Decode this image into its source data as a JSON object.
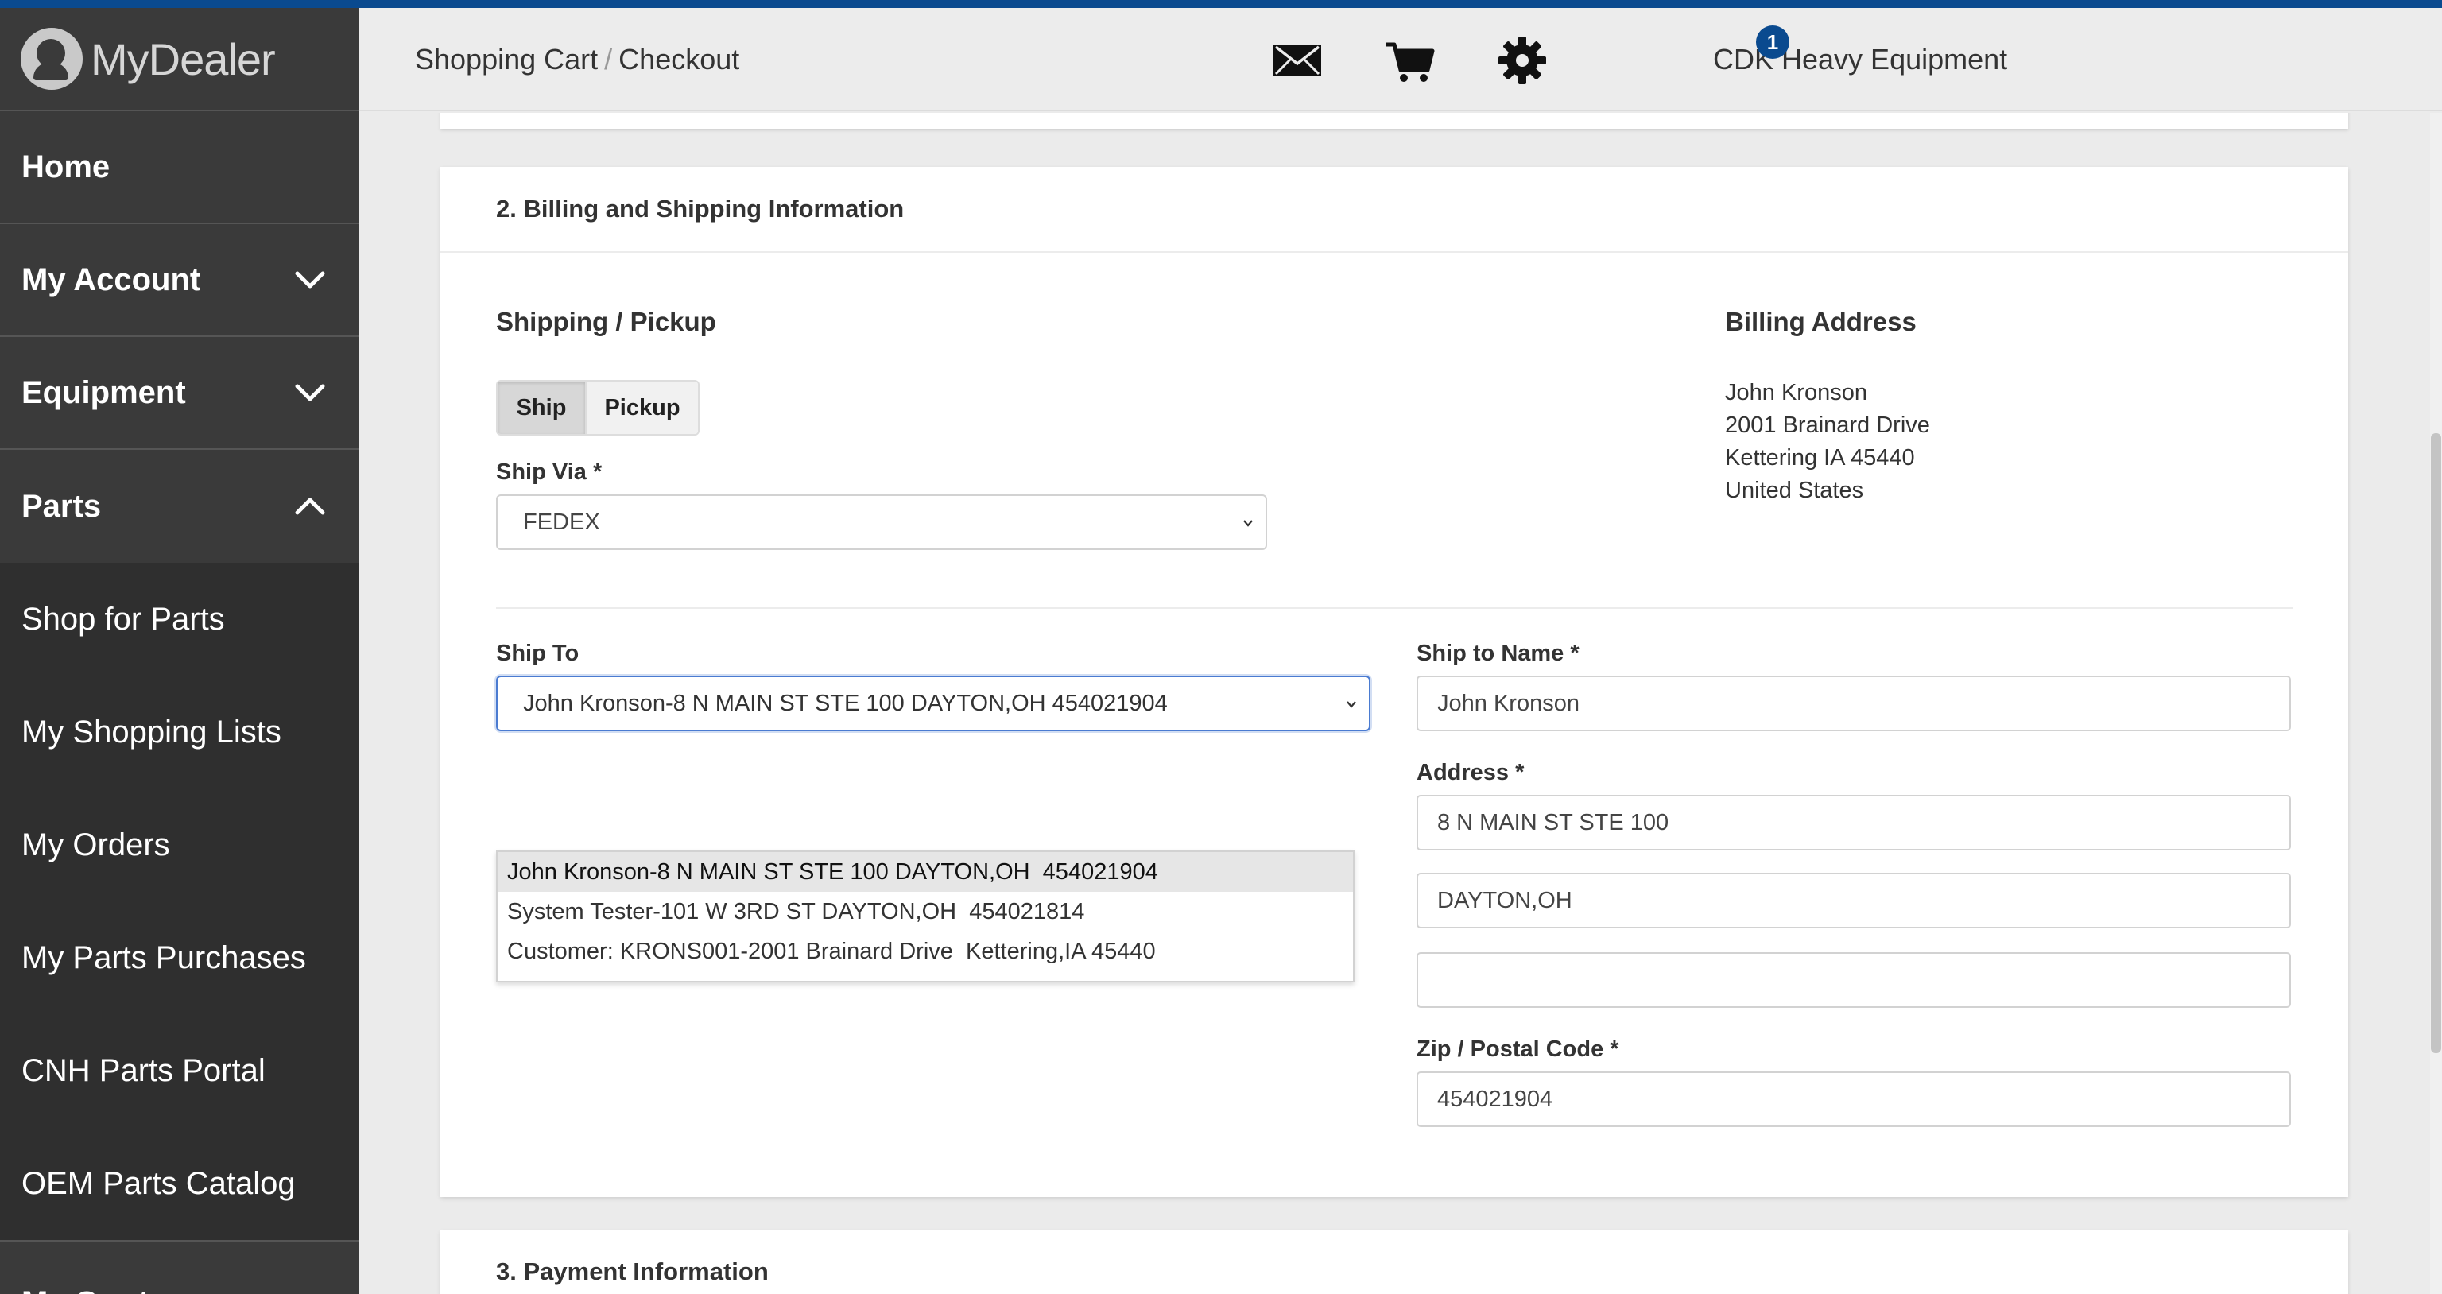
{
  "app": {
    "logo_text": "MyDealer"
  },
  "sidebar": {
    "items": [
      {
        "label": "Home"
      },
      {
        "label": "My Account"
      },
      {
        "label": "Equipment"
      },
      {
        "label": "Parts"
      }
    ],
    "parts_sub": [
      {
        "label": "Shop for Parts"
      },
      {
        "label": "My Shopping Lists"
      },
      {
        "label": "My Orders"
      },
      {
        "label": "My Parts Purchases"
      },
      {
        "label": "CNH Parts Portal"
      },
      {
        "label": "OEM Parts Catalog"
      }
    ],
    "next_item": "My Quotes"
  },
  "header": {
    "breadcrumb": [
      "Shopping Cart",
      "Checkout"
    ],
    "breadcrumb_sep": "/",
    "dealer_name": "CDK Heavy Equipment",
    "cart_count": "1",
    "icons": [
      "mail-icon",
      "cart-icon",
      "gear-icon"
    ]
  },
  "billing_shipping": {
    "title": "2. Billing and Shipping Information",
    "shipping_heading": "Shipping / Pickup",
    "toggle": {
      "ship": "Ship",
      "pickup": "Pickup",
      "selected": "Ship"
    },
    "ship_via_label": "Ship Via *",
    "ship_via_value": "FEDEX",
    "billing_heading": "Billing Address",
    "billing_address": [
      "John Kronson",
      "2001 Brainard Drive",
      "Kettering IA 45440",
      "United States"
    ],
    "ship_to_label": "Ship To",
    "ship_to_value": "John Kronson-8 N MAIN ST STE 100 DAYTON,OH 454021904",
    "ship_to_options": [
      "John Kronson-8 N MAIN ST STE 100 DAYTON,OH  454021904",
      "System Tester-101 W 3RD ST DAYTON,OH  454021814",
      "Customer: KRONS001-2001 Brainard Drive  Kettering,IA 45440"
    ],
    "ship_to_name_label": "Ship to Name *",
    "ship_to_name_value": "John Kronson",
    "address_label": "Address *",
    "address_line1": "8 N MAIN ST STE 100",
    "address_line2": "DAYTON,OH",
    "address_line3": "",
    "zip_label": "Zip / Postal Code *",
    "zip_value": "454021904"
  },
  "payment": {
    "title": "3. Payment Information"
  },
  "colors": {
    "accent": "#0a4a8f",
    "sidebar_bg": "#2f2f2f",
    "focus_border": "#4a7bd1"
  }
}
